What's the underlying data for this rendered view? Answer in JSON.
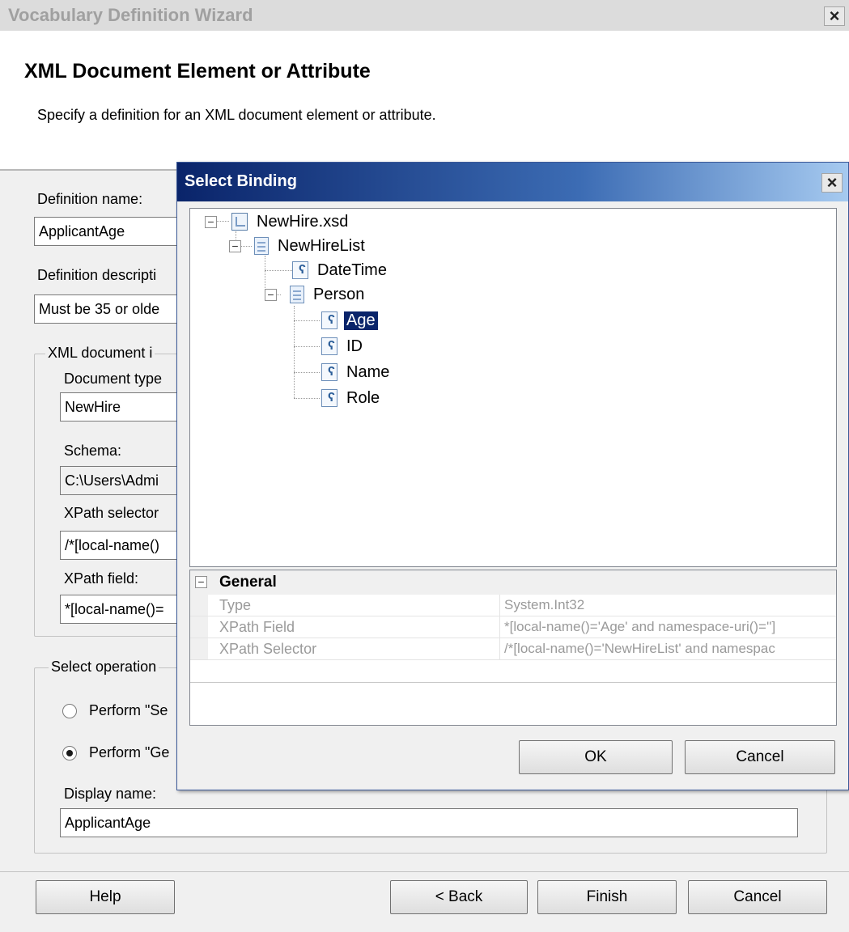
{
  "wizard": {
    "title": "Vocabulary Definition Wizard",
    "close_glyph": "×",
    "heading": "XML Document Element or Attribute",
    "subtitle": "Specify a definition for an XML document element or attribute.",
    "definition_name_label": "Definition name:",
    "definition_name_value": "ApplicantAge",
    "definition_description_label": "Definition descripti",
    "definition_description_value": "Must be 35 or olde",
    "xml_group_title": "XML document i",
    "document_type_label": "Document type",
    "document_type_value": "NewHire",
    "schema_label": "Schema:",
    "schema_value": "C:\\Users\\Admi",
    "xpath_selector_label": "XPath selector",
    "xpath_selector_value": "/*[local-name()",
    "xpath_field_label": "XPath field:",
    "xpath_field_value": "*[local-name()=",
    "operation_group_title": "Select operation",
    "radio_set_label": "Perform \"Se",
    "radio_get_label": "Perform \"Ge",
    "selected_operation": "get",
    "display_name_label": "Display name:",
    "display_name_value": "ApplicantAge",
    "buttons": {
      "help": "Help",
      "back": "< Back",
      "finish": "Finish",
      "cancel": "Cancel"
    }
  },
  "select_binding": {
    "title": "Select Binding",
    "close_glyph": "×",
    "tree": {
      "root": "NewHire.xsd",
      "record": "NewHireList",
      "datetime": "DateTime",
      "person": "Person",
      "age": "Age",
      "id": "ID",
      "name": "Name",
      "role": "Role",
      "selected": "Age",
      "collapse_glyph": "−",
      "field_glyph": "ʕ"
    },
    "properties": {
      "category": "General",
      "collapse_glyph": "−",
      "rows": [
        {
          "name": "Type",
          "value": "System.Int32"
        },
        {
          "name": "XPath Field",
          "value": "*[local-name()='Age' and namespace-uri()='']"
        },
        {
          "name": "XPath Selector",
          "value": "/*[local-name()='NewHireList' and namespac"
        }
      ]
    },
    "buttons": {
      "ok": "OK",
      "cancel": "Cancel"
    }
  }
}
